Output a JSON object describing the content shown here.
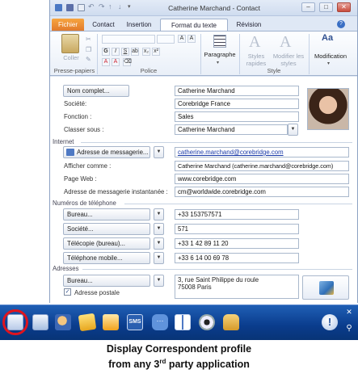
{
  "window": {
    "title": "Catherine Marchand  -  Contact",
    "controls": [
      "–",
      "□",
      "✕"
    ]
  },
  "tabs": {
    "fichier": "Fichier",
    "contact": "Contact",
    "insertion": "Insertion",
    "format": "Format du texte",
    "revision": "Révision"
  },
  "ribbon": {
    "coller": "Coller",
    "presse_papiers": "Presse-papiers",
    "police": "Police",
    "paragraphe": "Paragraphe",
    "styles_rapides": "Styles rapides",
    "modifier_styles": "Modifier les styles",
    "style": "Style",
    "modification": "Modification",
    "font_buttons": [
      "G",
      "I",
      "S",
      "A",
      "A"
    ]
  },
  "form": {
    "nom_complet_button": "Nom complet...",
    "nom_complet": "Catherine Marchand",
    "societe_label": "Société:",
    "societe": "Corebridge France",
    "fonction_label": "Fonction :",
    "fonction": "Sales",
    "classer_label": "Classer sous :",
    "classer": "Catherine Marchand",
    "internet_section": "Internet",
    "email_button": "Adresse de messagerie...",
    "email": "catherine.marchand@corebridge.com",
    "afficher_label": "Afficher comme :",
    "afficher": "Catherine Marchand (catherine.marchand@corebridge.com)",
    "web_label": "Page Web :",
    "web": "www.corebridge.com",
    "im_label": "Adresse de messagerie instantanée :",
    "im": "cm@worldwide.corebridge.com",
    "phone_section": "Numéros de téléphone",
    "phones": [
      {
        "label": "Bureau...",
        "value": "+33 153757571"
      },
      {
        "label": "Société...",
        "value": "571"
      },
      {
        "label": "Télécopie (bureau)...",
        "value": "+33 1 42 89 11 20"
      },
      {
        "label": "Téléphone mobile...",
        "value": "+33 6 14 00 69 78"
      }
    ],
    "addr_section": "Adresses",
    "addr_button": "Bureau...",
    "addr_line1": "3, rue Saint Philippe du roule",
    "addr_line2": "75008  Paris",
    "postal_label": "Adresse postale"
  },
  "taskbar": {
    "close_glyph": "✕",
    "pin_glyph": "⚲",
    "icons": [
      "correspondent-profile-icon",
      "contacts-icon",
      "user-search-icon",
      "notes-icon",
      "mail-icon",
      "sms-icon",
      "chat-icon",
      "address-book-icon",
      "webcam-icon",
      "hand-icon",
      "info-icon"
    ]
  },
  "caption": {
    "line1": "Display Correspondent profile",
    "line2_pre": "from any 3",
    "line2_sup": "rd",
    "line2_post": " party application"
  },
  "colors": {
    "taskbar": "#0a3c8c",
    "fichier_tab": "#e0772a",
    "highlight_circle": "#e0141e"
  }
}
